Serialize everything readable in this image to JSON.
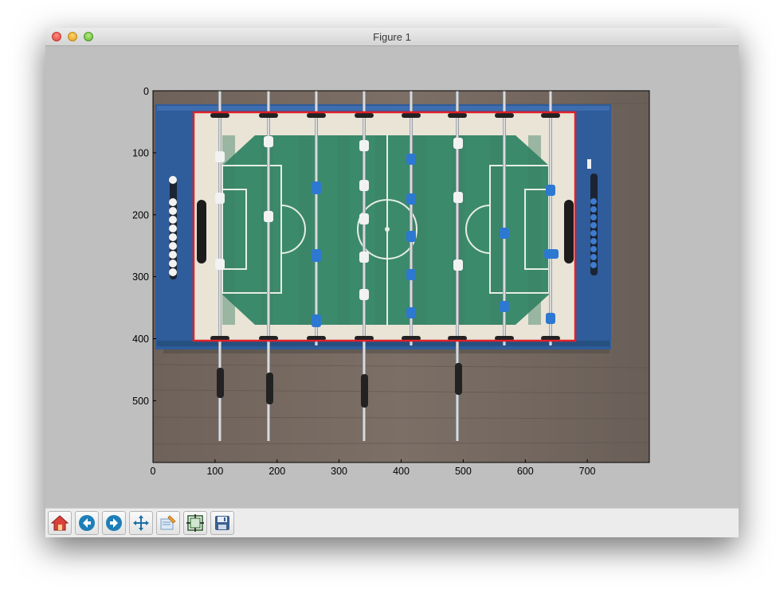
{
  "window": {
    "title": "Figure 1"
  },
  "plot": {
    "x_ticks": [
      "0",
      "100",
      "200",
      "300",
      "400",
      "500",
      "600",
      "700"
    ],
    "y_ticks": [
      "0",
      "100",
      "200",
      "300",
      "400",
      "500"
    ],
    "image_description_icon": "foosball-table-photo",
    "detection_box_color": "#e0202a"
  },
  "toolbar": {
    "buttons": [
      {
        "icon": "home-icon"
      },
      {
        "icon": "back-arrow-icon"
      },
      {
        "icon": "forward-arrow-icon"
      },
      {
        "icon": "pan-move-icon"
      },
      {
        "icon": "zoom-rect-icon"
      },
      {
        "icon": "subplots-config-icon"
      },
      {
        "icon": "save-disk-icon"
      }
    ]
  }
}
